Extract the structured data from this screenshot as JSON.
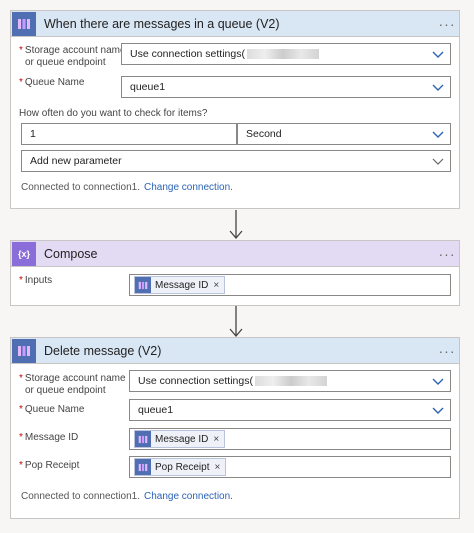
{
  "card1": {
    "title": "When there are messages in a queue (V2)",
    "menu": "···",
    "storage_label_1": "Storage account name",
    "storage_label_2": "or queue endpoint",
    "storage_value": "Use connection settings(",
    "queue_label": "Queue Name",
    "queue_value": "queue1",
    "interval_label": "How often do you want to check for items?",
    "interval_value": "1",
    "frequency_value": "Second",
    "add_param": "Add new parameter",
    "connected_text": "Connected to connection1.",
    "change_link": "Change connection."
  },
  "card2": {
    "title": "Compose",
    "menu": "···",
    "inputs_label": "Inputs",
    "token_label": "Message ID",
    "icon_text": "{x}"
  },
  "card3": {
    "title": "Delete message (V2)",
    "menu": "···",
    "storage_label_1": "Storage account name",
    "storage_label_2": "or queue endpoint",
    "storage_value": "Use connection settings(",
    "queue_label": "Queue Name",
    "queue_value": "queue1",
    "message_id_label": "Message ID",
    "message_id_token": "Message ID",
    "pop_receipt_label": "Pop Receipt",
    "pop_receipt_token": "Pop Receipt",
    "connected_text": "Connected to connection1.",
    "change_link": "Change connection."
  },
  "required_mark": "*",
  "remove_mark": "×",
  "colors": {
    "accent_blue": "#4f6fb2",
    "compose_purple": "#8a6dd8",
    "link": "#2b63b5"
  },
  "icons": [
    "queue-icon",
    "compose-icon",
    "chevron-down-icon",
    "close-icon",
    "arrow-down-icon",
    "more-icon"
  ]
}
